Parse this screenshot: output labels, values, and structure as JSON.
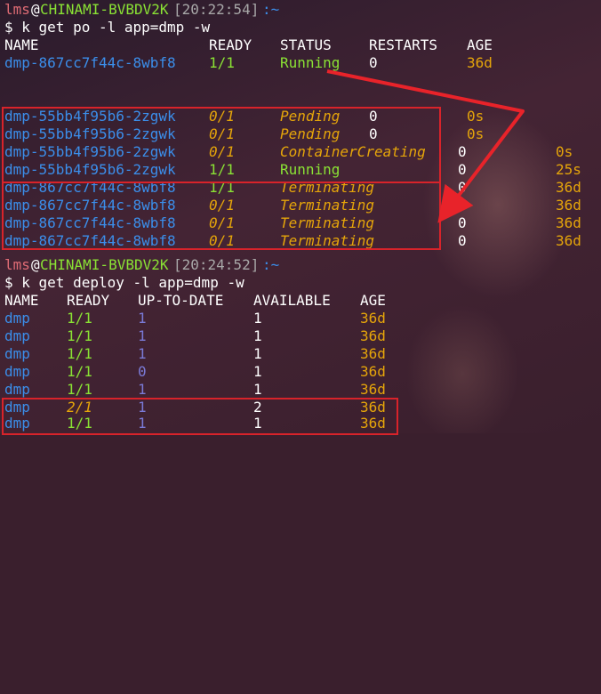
{
  "prompt1": {
    "user": "lms",
    "at": "@",
    "host": "CHINAMI-BVBDV2K",
    "time": "[20:22:54]",
    "tail": ":~",
    "command": "$ k get po -l app=dmp -w"
  },
  "pods_header": [
    "NAME",
    "READY",
    "STATUS",
    "RESTARTS",
    "AGE"
  ],
  "pods_first": {
    "name": "dmp-867cc7f44c-8wbf8",
    "ready": "1/1",
    "status": "Running",
    "restarts": "0",
    "age": "36d"
  },
  "pods_rows": [
    {
      "name": "dmp-55bb4f95b6-2zgwk",
      "ready": "0/1",
      "status": "Pending",
      "restarts": "0",
      "age": "0s",
      "ready_color": "orange",
      "status_color": "orange"
    },
    {
      "name": "dmp-55bb4f95b6-2zgwk",
      "ready": "0/1",
      "status": "Pending",
      "restarts": "0",
      "age": "0s",
      "ready_color": "orange",
      "status_color": "orange"
    },
    {
      "name": "dmp-55bb4f95b6-2zgwk",
      "ready": "0/1",
      "status": "ContainerCreating",
      "restarts": "0",
      "age": "0s",
      "ready_color": "orange",
      "status_color": "orange"
    },
    {
      "name": "dmp-55bb4f95b6-2zgwk",
      "ready": "1/1",
      "status": "Running",
      "restarts": "0",
      "age": "25s",
      "ready_color": "green",
      "status_color": "green"
    },
    {
      "name": "dmp-867cc7f44c-8wbf8",
      "ready": "1/1",
      "status": "Terminating",
      "restarts": "0",
      "age": "36d",
      "ready_color": "green",
      "status_color": "orange"
    },
    {
      "name": "dmp-867cc7f44c-8wbf8",
      "ready": "0/1",
      "status": "Terminating",
      "restarts": "0",
      "age": "36d",
      "ready_color": "orange",
      "status_color": "orange"
    },
    {
      "name": "dmp-867cc7f44c-8wbf8",
      "ready": "0/1",
      "status": "Terminating",
      "restarts": "0",
      "age": "36d",
      "ready_color": "orange",
      "status_color": "orange"
    },
    {
      "name": "dmp-867cc7f44c-8wbf8",
      "ready": "0/1",
      "status": "Terminating",
      "restarts": "0",
      "age": "36d",
      "ready_color": "orange",
      "status_color": "orange"
    }
  ],
  "prompt2": {
    "user": "lms",
    "at": "@",
    "host": "CHINAMI-BVBDV2K",
    "time": "[20:24:52]",
    "tail": ":~",
    "command": "$ k get deploy -l app=dmp -w"
  },
  "deploy_header": [
    "NAME",
    "READY",
    "UP-TO-DATE",
    "AVAILABLE",
    "AGE"
  ],
  "deploy_rows": [
    {
      "name": "dmp",
      "ready": "1/1",
      "uptodate": "1",
      "available": "1",
      "age": "36d",
      "ready_color": "green"
    },
    {
      "name": "dmp",
      "ready": "1/1",
      "uptodate": "1",
      "available": "1",
      "age": "36d",
      "ready_color": "green"
    },
    {
      "name": "dmp",
      "ready": "1/1",
      "uptodate": "1",
      "available": "1",
      "age": "36d",
      "ready_color": "green"
    },
    {
      "name": "dmp",
      "ready": "1/1",
      "uptodate": "0",
      "available": "1",
      "age": "36d",
      "ready_color": "green"
    },
    {
      "name": "dmp",
      "ready": "1/1",
      "uptodate": "1",
      "available": "1",
      "age": "36d",
      "ready_color": "green"
    },
    {
      "name": "dmp",
      "ready": "2/1",
      "uptodate": "1",
      "available": "2",
      "age": "36d",
      "ready_color": "orange"
    },
    {
      "name": "dmp",
      "ready": "1/1",
      "uptodate": "1",
      "available": "1",
      "age": "36d",
      "ready_color": "green"
    }
  ],
  "colors": {
    "highlight_box": "#d8232a",
    "arrow": "#e8232a",
    "name": "#3b8eea",
    "green": "#8ae234",
    "orange": "#e5a50a"
  }
}
